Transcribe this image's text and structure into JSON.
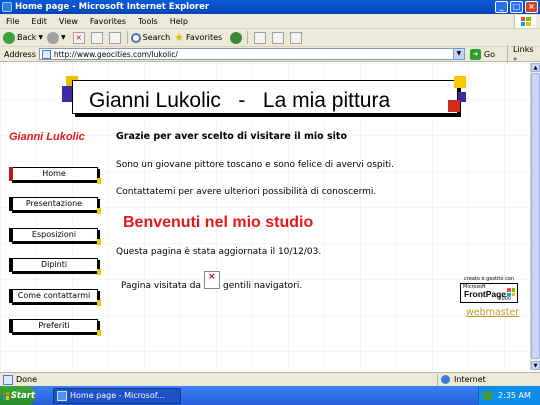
{
  "window": {
    "title": "Home page - Microsoft Internet Explorer"
  },
  "menu": {
    "items": [
      "File",
      "Edit",
      "View",
      "Favorites",
      "Tools",
      "Help"
    ]
  },
  "toolbar": {
    "back_label": "Back",
    "search_label": "Search",
    "favorites_label": "Favorites"
  },
  "address": {
    "label": "Address",
    "url": "http://www.geocities.com/lukolic/",
    "go_label": "Go",
    "links_label": "Links"
  },
  "page": {
    "banner_title": "Gianni Lukolic   -   La mia pittura",
    "site_name": "Gianni Lukolic",
    "nav": [
      "Home",
      "Presentazione",
      "Esposizioni",
      "Dipinti",
      "Come contattarmi",
      "Preferiti"
    ],
    "welcome": "Grazie per aver scelto di visitare il mio sito",
    "intro": "Sono un giovane pittore toscano e sono felice di avervi ospiti.",
    "contact": "Contattatemi per avere ulteriori possibilità di conoscermi.",
    "studio": "Benvenuti nel mio studio",
    "updated": "Questa pagina è stata aggiornata il 10/12/03.",
    "counter_prefix": "Pagina visitata da",
    "counter_suffix": "gentili navigatori.",
    "frontpage_caption": "creato e gestito con",
    "frontpage_ms": "Microsoft",
    "frontpage_name": "FrontPage",
    "frontpage_year": "2000",
    "webmaster": "webmaster"
  },
  "status": {
    "text": "Done",
    "zone": "Internet"
  },
  "taskbar": {
    "start_label": "Start",
    "task_label": "Home page - Microsof...",
    "clock": "2:35 AM"
  },
  "colors": {
    "accent_red": "#e01818",
    "webmaster_link": "#c09a2e",
    "titlebar_blue": "#0a5ad8"
  }
}
